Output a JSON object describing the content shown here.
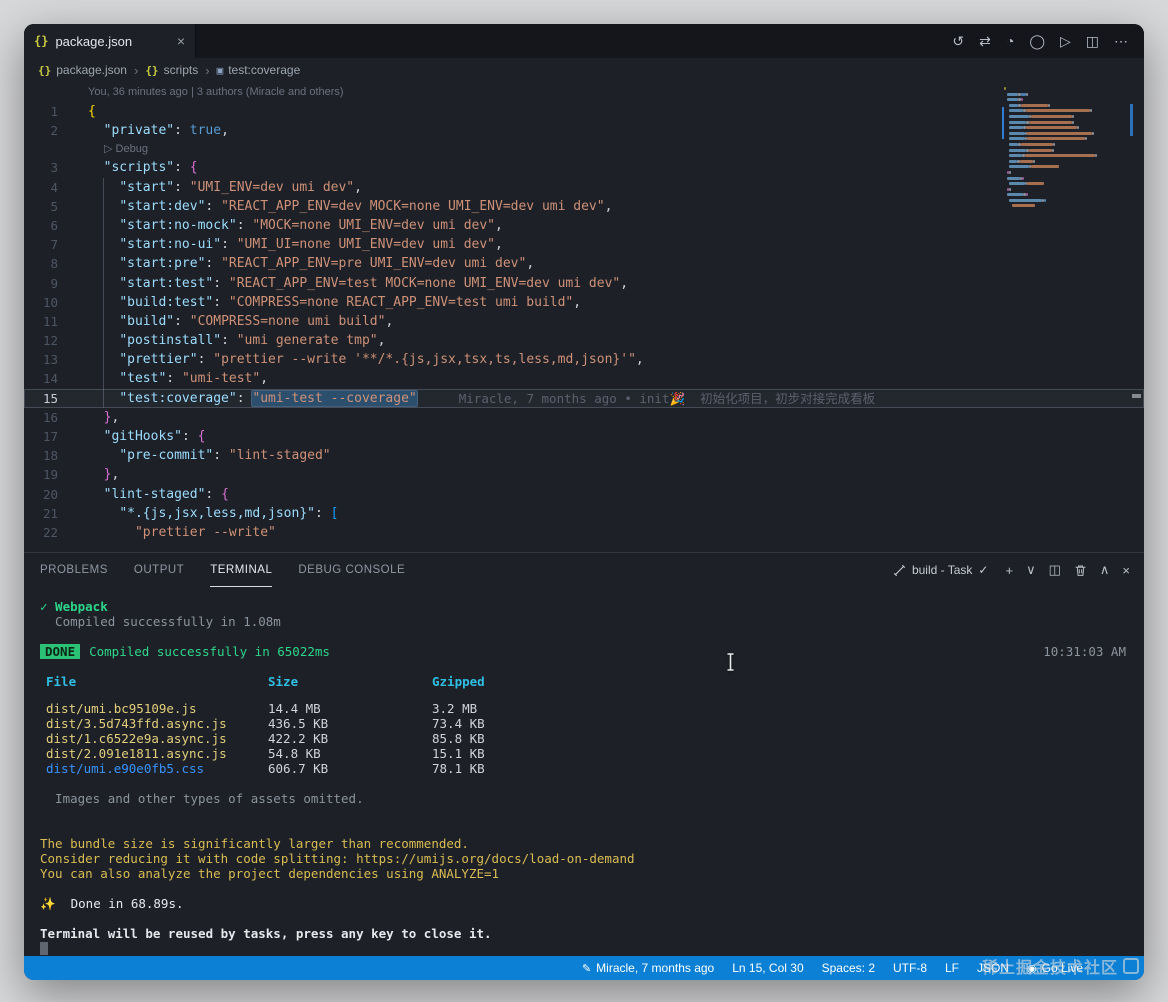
{
  "tab": {
    "icon": "{}",
    "title": "package.json",
    "close": "×"
  },
  "editor_actions": [
    {
      "name": "timeline-icon",
      "glyph": "↺"
    },
    {
      "name": "open-changes-icon",
      "glyph": "⇄"
    },
    {
      "name": "heatmap-annotations-icon",
      "glyph": "◔"
    },
    {
      "name": "blame-annotations-icon",
      "glyph": "◯"
    },
    {
      "name": "run-script-icon",
      "glyph": "▷"
    },
    {
      "name": "split-editor-icon",
      "glyph": "◫"
    },
    {
      "name": "more-actions-icon",
      "glyph": "⋯"
    }
  ],
  "breadcrumb": {
    "separator": "›",
    "items": [
      {
        "icon": "{}",
        "icon_color": "#cbcb41",
        "label": "package.json"
      },
      {
        "icon": "{}",
        "icon_color": "#cbcb41",
        "label": "scripts"
      },
      {
        "icon": "▣",
        "icon_color": "#8aa3c0",
        "label": "test:coverage"
      }
    ]
  },
  "editor": {
    "blame_header": "You, 36 minutes ago | 3 authors (Miracle and others)",
    "codelens": {
      "glyph": "▷",
      "label": "Debug"
    },
    "codelens_after_line": 2,
    "current_line": 15,
    "inline_blame": "Miracle, 7 months ago • init🎉  初始化项目，初步对接完成看板",
    "lines": [
      {
        "n": 1,
        "tokens": [
          [
            "{",
            "b1"
          ]
        ]
      },
      {
        "n": 2,
        "tokens": [
          [
            "  ",
            "pln"
          ],
          [
            "\"private\"",
            "key"
          ],
          [
            ": ",
            "pun"
          ],
          [
            "true",
            "kw"
          ],
          [
            ",",
            "pun"
          ]
        ]
      },
      {
        "n": 3,
        "tokens": [
          [
            "  ",
            "pln"
          ],
          [
            "\"scripts\"",
            "key"
          ],
          [
            ": ",
            "pun"
          ],
          [
            "{",
            "b2"
          ]
        ]
      },
      {
        "n": 4,
        "tokens": [
          [
            "    ",
            "pln"
          ],
          [
            "\"start\"",
            "key"
          ],
          [
            ": ",
            "pun"
          ],
          [
            "\"UMI_ENV=dev umi dev\"",
            "str"
          ],
          [
            ",",
            "pun"
          ]
        ]
      },
      {
        "n": 5,
        "tokens": [
          [
            "    ",
            "pln"
          ],
          [
            "\"start:dev\"",
            "key"
          ],
          [
            ": ",
            "pun"
          ],
          [
            "\"REACT_APP_ENV=dev MOCK=none UMI_ENV=dev umi dev\"",
            "str"
          ],
          [
            ",",
            "pun"
          ]
        ]
      },
      {
        "n": 6,
        "tokens": [
          [
            "    ",
            "pln"
          ],
          [
            "\"start:no-mock\"",
            "key"
          ],
          [
            ": ",
            "pun"
          ],
          [
            "\"MOCK=none UMI_ENV=dev umi dev\"",
            "str"
          ],
          [
            ",",
            "pun"
          ]
        ]
      },
      {
        "n": 7,
        "tokens": [
          [
            "    ",
            "pln"
          ],
          [
            "\"start:no-ui\"",
            "key"
          ],
          [
            ": ",
            "pun"
          ],
          [
            "\"UMI_UI=none UMI_ENV=dev umi dev\"",
            "str"
          ],
          [
            ",",
            "pun"
          ]
        ]
      },
      {
        "n": 8,
        "tokens": [
          [
            "    ",
            "pln"
          ],
          [
            "\"start:pre\"",
            "key"
          ],
          [
            ": ",
            "pun"
          ],
          [
            "\"REACT_APP_ENV=pre UMI_ENV=dev umi dev\"",
            "str"
          ],
          [
            ",",
            "pun"
          ]
        ]
      },
      {
        "n": 9,
        "tokens": [
          [
            "    ",
            "pln"
          ],
          [
            "\"start:test\"",
            "key"
          ],
          [
            ": ",
            "pun"
          ],
          [
            "\"REACT_APP_ENV=test MOCK=none UMI_ENV=dev umi dev\"",
            "str"
          ],
          [
            ",",
            "pun"
          ]
        ]
      },
      {
        "n": 10,
        "tokens": [
          [
            "    ",
            "pln"
          ],
          [
            "\"build:test\"",
            "key"
          ],
          [
            ": ",
            "pun"
          ],
          [
            "\"COMPRESS=none REACT_APP_ENV=test umi build\"",
            "str"
          ],
          [
            ",",
            "pun"
          ]
        ]
      },
      {
        "n": 11,
        "tokens": [
          [
            "    ",
            "pln"
          ],
          [
            "\"build\"",
            "key"
          ],
          [
            ": ",
            "pun"
          ],
          [
            "\"COMPRESS=none umi build\"",
            "str"
          ],
          [
            ",",
            "pun"
          ]
        ]
      },
      {
        "n": 12,
        "tokens": [
          [
            "    ",
            "pln"
          ],
          [
            "\"postinstall\"",
            "key"
          ],
          [
            ": ",
            "pun"
          ],
          [
            "\"umi generate tmp\"",
            "str"
          ],
          [
            ",",
            "pun"
          ]
        ]
      },
      {
        "n": 13,
        "tokens": [
          [
            "    ",
            "pln"
          ],
          [
            "\"prettier\"",
            "key"
          ],
          [
            ": ",
            "pun"
          ],
          [
            "\"prettier --write '**/*.{js,jsx,tsx,ts,less,md,json}'\"",
            "str"
          ],
          [
            ",",
            "pun"
          ]
        ]
      },
      {
        "n": 14,
        "tokens": [
          [
            "    ",
            "pln"
          ],
          [
            "\"test\"",
            "key"
          ],
          [
            ": ",
            "pun"
          ],
          [
            "\"umi-test\"",
            "str"
          ],
          [
            ",",
            "pun"
          ]
        ]
      },
      {
        "n": 15,
        "tokens": [
          [
            "    ",
            "pln"
          ],
          [
            "\"test:coverage\"",
            "key"
          ],
          [
            ": ",
            "pun"
          ],
          [
            "\"umi-test --coverage\"",
            "strsel"
          ]
        ]
      },
      {
        "n": 16,
        "tokens": [
          [
            "  ",
            "pln"
          ],
          [
            "}",
            "b2"
          ],
          [
            ",",
            "pun"
          ]
        ]
      },
      {
        "n": 17,
        "tokens": [
          [
            "  ",
            "pln"
          ],
          [
            "\"gitHooks\"",
            "key"
          ],
          [
            ": ",
            "pun"
          ],
          [
            "{",
            "b2"
          ]
        ]
      },
      {
        "n": 18,
        "tokens": [
          [
            "    ",
            "pln"
          ],
          [
            "\"pre-commit\"",
            "key"
          ],
          [
            ": ",
            "pun"
          ],
          [
            "\"lint-staged\"",
            "str"
          ]
        ]
      },
      {
        "n": 19,
        "tokens": [
          [
            "  ",
            "pln"
          ],
          [
            "}",
            "b2"
          ],
          [
            ",",
            "pun"
          ]
        ]
      },
      {
        "n": 20,
        "tokens": [
          [
            "  ",
            "pln"
          ],
          [
            "\"lint-staged\"",
            "key"
          ],
          [
            ": ",
            "pun"
          ],
          [
            "{",
            "b2"
          ]
        ]
      },
      {
        "n": 21,
        "tokens": [
          [
            "    ",
            "pln"
          ],
          [
            "\"*.{js,jsx,less,md,json}\"",
            "key"
          ],
          [
            ": ",
            "pun"
          ],
          [
            "[",
            "b3"
          ]
        ]
      },
      {
        "n": 22,
        "tokens": [
          [
            "      ",
            "pln"
          ],
          [
            "\"prettier --write\"",
            "str"
          ]
        ]
      }
    ]
  },
  "panel": {
    "tabs": [
      {
        "label": "PROBLEMS",
        "active": false
      },
      {
        "label": "OUTPUT",
        "active": false
      },
      {
        "label": "TERMINAL",
        "active": true
      },
      {
        "label": "DEBUG CONSOLE",
        "active": false
      }
    ],
    "task": {
      "label": "build - Task",
      "check": "✓"
    },
    "actions": [
      {
        "name": "new-terminal-icon",
        "glyph": "+"
      },
      {
        "name": "terminal-dropdown-icon",
        "glyph": "∨"
      },
      {
        "name": "split-terminal-icon",
        "glyph": "◫"
      },
      {
        "name": "kill-terminal-icon",
        "glyph": ""
      },
      {
        "name": "maximize-panel-icon",
        "glyph": "∧"
      },
      {
        "name": "close-panel-icon",
        "glyph": "×"
      }
    ]
  },
  "terminal": {
    "done": {
      "badge": "DONE",
      "message": "Compiled successfully in 65022ms",
      "time": "10:31:03 AM"
    },
    "table": {
      "headers": [
        "File",
        "Size",
        "Gzipped"
      ],
      "rows": [
        {
          "file": "dist/umi.bc95109e.js",
          "size": "14.4 MB",
          "gzip": "3.2 MB",
          "color": "yellow"
        },
        {
          "file": "dist/3.5d743ffd.async.js",
          "size": "436.5 KB",
          "gzip": "73.4 KB",
          "color": "yellow"
        },
        {
          "file": "dist/1.c6522e9a.async.js",
          "size": "422.2 KB",
          "gzip": "85.8 KB",
          "color": "yellow"
        },
        {
          "file": "dist/2.091e1811.async.js",
          "size": "54.8 KB",
          "gzip": "15.1 KB",
          "color": "yellow"
        },
        {
          "file": "dist/umi.e90e0fb5.css",
          "size": "606.7 KB",
          "gzip": "78.1 KB",
          "color": "blue"
        }
      ]
    },
    "lines": [
      {
        "seg": [
          [
            "✓ Webpack",
            "green"
          ]
        ]
      },
      {
        "seg": [
          [
            "  Compiled successfully in 1.08m",
            "dim"
          ]
        ]
      },
      {
        "blank": true
      },
      {
        "done": true
      },
      {
        "blank": true
      },
      {
        "thead": true
      },
      {
        "row": 0
      },
      {
        "row": 1
      },
      {
        "row": 2
      },
      {
        "row": 3
      },
      {
        "row": 4
      },
      {
        "blank": true
      },
      {
        "seg": [
          [
            "  Images and other types of assets omitted.",
            "dim"
          ]
        ]
      },
      {
        "blank": true
      },
      {
        "blank": true
      },
      {
        "seg": [
          [
            "The bundle size is significantly larger than recommended.",
            "yellow"
          ]
        ]
      },
      {
        "seg": [
          [
            "Consider reducing it with code splitting: https://umijs.org/docs/load-on-demand",
            "yellow"
          ]
        ]
      },
      {
        "seg": [
          [
            "You can also analyze the project dependencies using ANALYZE=1",
            "yellow"
          ]
        ]
      },
      {
        "blank": true
      },
      {
        "seg": [
          [
            "✨  ",
            "yellow"
          ],
          [
            "Done in 68.89s.",
            "fg"
          ]
        ]
      },
      {
        "blank": true
      },
      {
        "seg": [
          [
            "Terminal will be reused by tasks, press any key to close it.",
            "fgb"
          ]
        ]
      },
      {
        "cursor": true
      }
    ]
  },
  "statusbar": {
    "items": [
      {
        "name": "git-blame",
        "icon": "✎",
        "label": "Miracle, 7 months ago"
      },
      {
        "name": "cursor-position",
        "label": "Ln 15, Col 30"
      },
      {
        "name": "indentation",
        "label": "Spaces: 2"
      },
      {
        "name": "encoding",
        "label": "UTF-8"
      },
      {
        "name": "eol",
        "label": "LF"
      },
      {
        "name": "language-mode",
        "label": "JSON"
      },
      {
        "name": "go-live",
        "icon": "◉",
        "label": "Go Live"
      }
    ]
  },
  "watermark": {
    "text": "稀土掘金技术社区"
  },
  "colors": {
    "accent": "#0b80d4",
    "done_green": "#2bc275",
    "warning_yellow": "#d9bc52"
  }
}
